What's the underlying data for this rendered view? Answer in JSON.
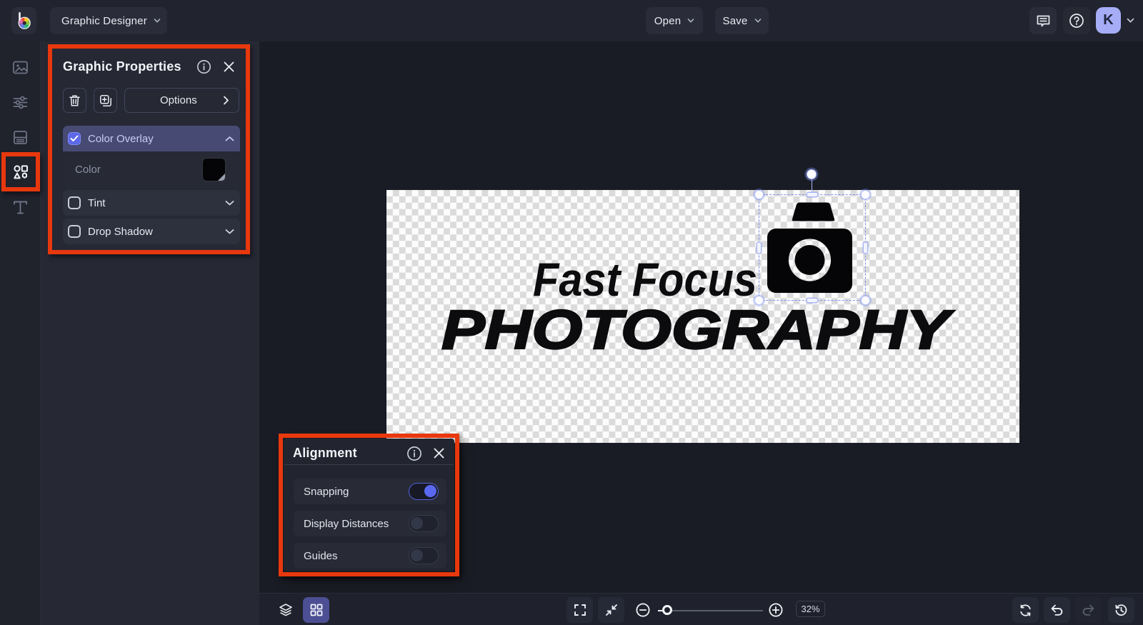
{
  "topbar": {
    "mode_label": "Graphic Designer",
    "open_label": "Open",
    "save_label": "Save",
    "avatar_initial": "K"
  },
  "graphic_properties": {
    "title": "Graphic Properties",
    "options_label": "Options",
    "sections": [
      {
        "label": "Color Overlay",
        "checked": true,
        "expanded": true
      },
      {
        "label": "Tint",
        "checked": false,
        "expanded": false
      },
      {
        "label": "Drop Shadow",
        "checked": false,
        "expanded": false
      }
    ],
    "color_field": {
      "label": "Color",
      "value": "#000000"
    }
  },
  "alignment": {
    "title": "Alignment",
    "toggles": [
      {
        "label": "Snapping",
        "on": true
      },
      {
        "label": "Display Distances",
        "on": false
      },
      {
        "label": "Guides",
        "on": false
      }
    ]
  },
  "canvas": {
    "logo_line1": "Fast Focus",
    "logo_line2": "PHOTOGRAPHY"
  },
  "bottombar": {
    "zoom_percent": "32%"
  },
  "colors": {
    "annotation_red": "#e8380d",
    "accent_indigo": "#5b68e8",
    "overlay_row": "#474b74",
    "swatch_value": "#050507"
  }
}
